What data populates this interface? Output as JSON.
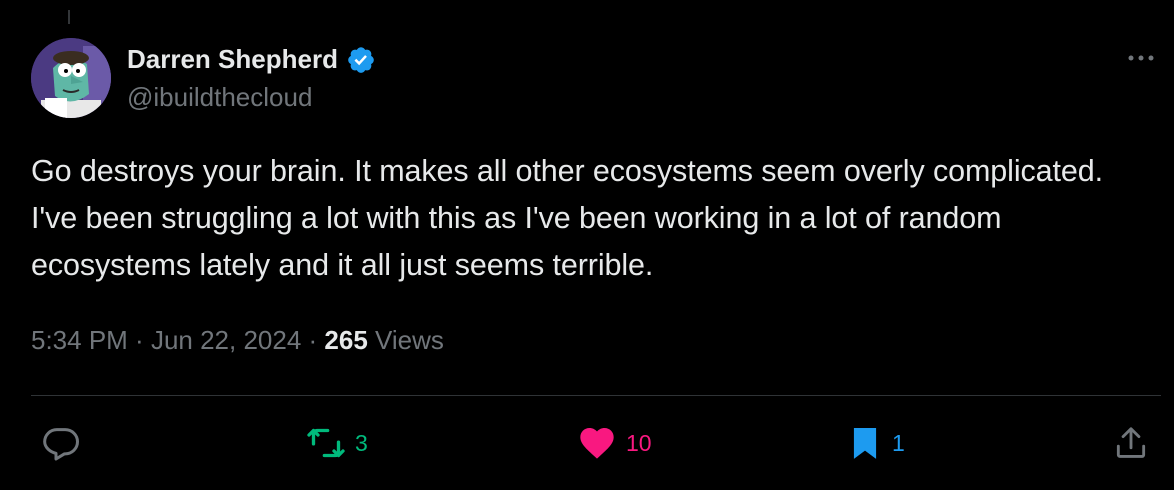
{
  "tweet": {
    "author": {
      "display_name": "Darren Shepherd",
      "handle": "@ibuildthecloud",
      "verified_icon": "verified-badge-icon",
      "avatar": "cartoon-avatar"
    },
    "text": "Go destroys your brain. It makes all other ecosystems seem overly complicated. I've been struggling a lot with this as I've been working in a lot of random ecosystems lately and it all just seems terrible.",
    "time": "5:34 PM",
    "separator": " · ",
    "date": "Jun 22, 2024",
    "views_count": "265",
    "views_label": " Views"
  },
  "actions": {
    "reply": {
      "icon": "reply-icon",
      "count": ""
    },
    "retweet": {
      "icon": "retweet-icon",
      "count": "3",
      "color": "#00ba7c"
    },
    "like": {
      "icon": "heart-icon",
      "count": "10",
      "color": "#f91880"
    },
    "bookmark": {
      "icon": "bookmark-icon",
      "count": "1",
      "color": "#1d9bf0"
    },
    "share": {
      "icon": "share-icon"
    }
  },
  "colors": {
    "background": "#000000",
    "text": "#e7e9ea",
    "muted": "#71767b",
    "verified": "#1d9bf0"
  }
}
